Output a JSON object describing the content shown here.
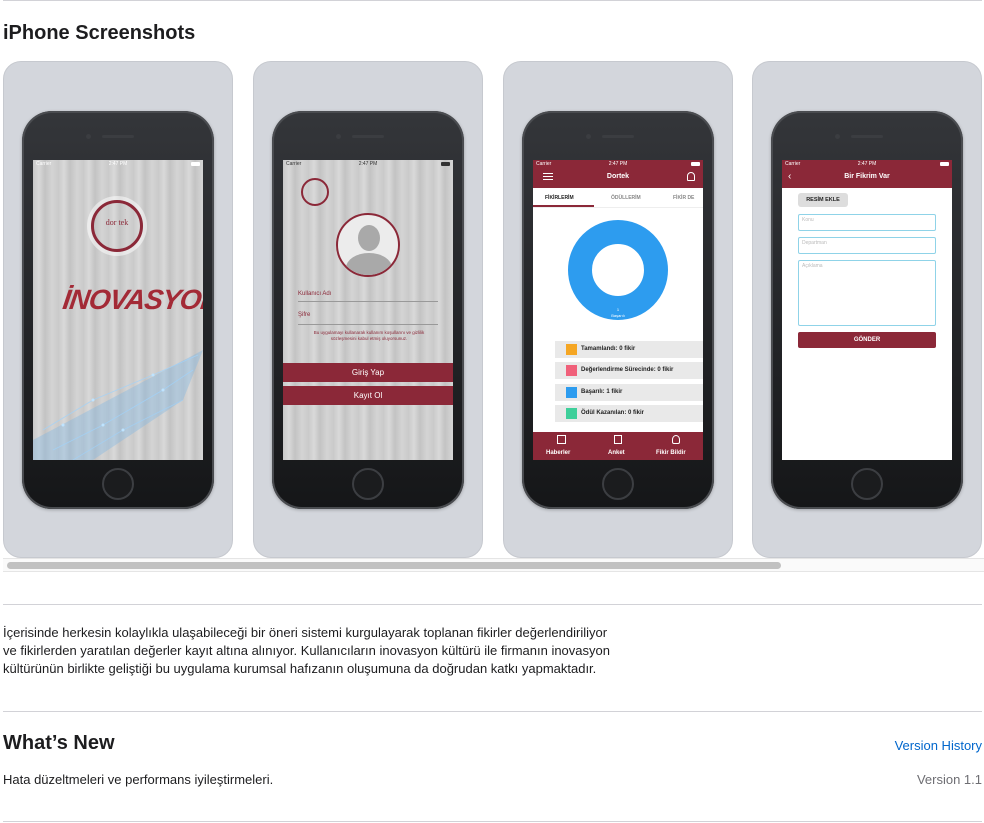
{
  "screenshots": {
    "title": "iPhone Screenshots",
    "shot1": {
      "logo_text": "dor tek",
      "splash_title": "İNOVASYON",
      "carrier": "Carrier",
      "time": "2:47 PM"
    },
    "shot2": {
      "carrier": "Carrier",
      "time": "2:47 PM",
      "username_label": "Kullanıcı Adı",
      "password_label": "Şifre",
      "terms_text": "Bu uygulamayı kullanarak kullanım koşullarını ve gizlilik sözleşmesini kabul etmiş oluyorsunuz.",
      "login_button": "Giriş Yap",
      "register_button": "Kayıt Ol"
    },
    "shot3": {
      "carrier": "Carrier",
      "time": "2:47 PM",
      "nav_title": "Dortek",
      "tabs": [
        "FİKİRLERİM",
        "ÖDÜLLERİM",
        "FİKİR DE"
      ],
      "donut_value": "1",
      "donut_label": "Başarılı",
      "legend": [
        {
          "label": "Tamamlandı: 0 fikir",
          "color": "#f5a623"
        },
        {
          "label": "Değerlendirme Sürecinde: 0 fikir",
          "color": "#f0607a"
        },
        {
          "label": "Başarılı: 1 fikir",
          "color": "#2d9cef"
        },
        {
          "label": "Ödül Kazanılan: 0 fikir",
          "color": "#3ecf9a"
        }
      ],
      "bottom_tabs": [
        "Haberler",
        "Anket",
        "Fikir Bildir"
      ]
    },
    "shot4": {
      "carrier": "Carrier",
      "time": "2:47 PM",
      "nav_title": "Bir Fikrim Var",
      "add_image_button": "RESİM EKLE",
      "subject_placeholder": "Konu",
      "department_placeholder": "Departman",
      "description_placeholder": "Açıklama",
      "send_button": "GÖNDER"
    }
  },
  "description": {
    "lines": [
      "İçerisinde herkesin kolaylıkla ulaşabileceği bir öneri sistemi kurgulayarak toplanan fikirler değerlendiriliyor",
      "ve fikirlerden yaratılan değerler kayıt altına alınıyor. Kullanıcıların inovasyon kültürü ile firmanın inovasyon",
      "kültürünün birlikte geliştiği bu uygulama kurumsal hafızanın oluşumuna da doğrudan katkı yapmaktadır."
    ]
  },
  "whats_new": {
    "title": "What’s New",
    "version_history_link": "Version History",
    "notes": "Hata düzeltmeleri ve performans iyileştirmeleri.",
    "version": "Version 1.1"
  },
  "colors": {
    "accent": "#8b2838",
    "link": "#0066cc",
    "donut": "#2d9cef"
  }
}
